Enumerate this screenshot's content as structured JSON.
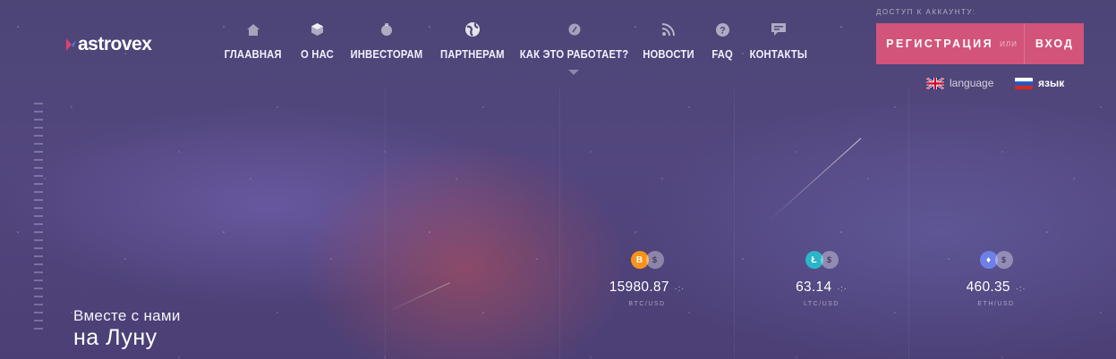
{
  "brand": {
    "name": "astrovex"
  },
  "nav": {
    "items": [
      {
        "label": "ГЛААВНАЯ",
        "icon": "home-icon"
      },
      {
        "label": "О НАС",
        "icon": "cube-icon"
      },
      {
        "label": "ИНВЕСТОРАМ",
        "icon": "moneybag-icon"
      },
      {
        "label": "ПАРТНЕРАМ",
        "icon": "globe-icon"
      },
      {
        "label": "КАК ЭТО РАБОТАЕТ?",
        "icon": "gear-icon"
      },
      {
        "label": "НОВОСТИ",
        "icon": "rss-icon"
      },
      {
        "label": "FAQ",
        "icon": "question-icon"
      },
      {
        "label": "КОНТАКТЫ",
        "icon": "chat-icon"
      }
    ]
  },
  "account": {
    "access_label": "ДОСТУП К АККАУНТУ:",
    "register_label": "РЕГИСТРАЦИЯ",
    "or_label": "ИЛИ",
    "login_label": "ВХОД"
  },
  "language": {
    "english_label": "language",
    "russian_label": "язык"
  },
  "hero": {
    "line1": "Вместе с нами",
    "line2": "на Луну"
  },
  "tickers": [
    {
      "symbol": "B",
      "value": "15980.87",
      "pair": "BTC/USD",
      "coin_color": "#f7931a"
    },
    {
      "symbol": "Ł",
      "value": "63.14",
      "pair": "LTC/USD",
      "coin_color": "#2bb5c9"
    },
    {
      "symbol": "♦",
      "value": "460.35",
      "pair": "ETH/USD",
      "coin_color": "#6f7fe8"
    }
  ],
  "colors": {
    "accent": "#d2547a",
    "background": "#4f4479"
  }
}
